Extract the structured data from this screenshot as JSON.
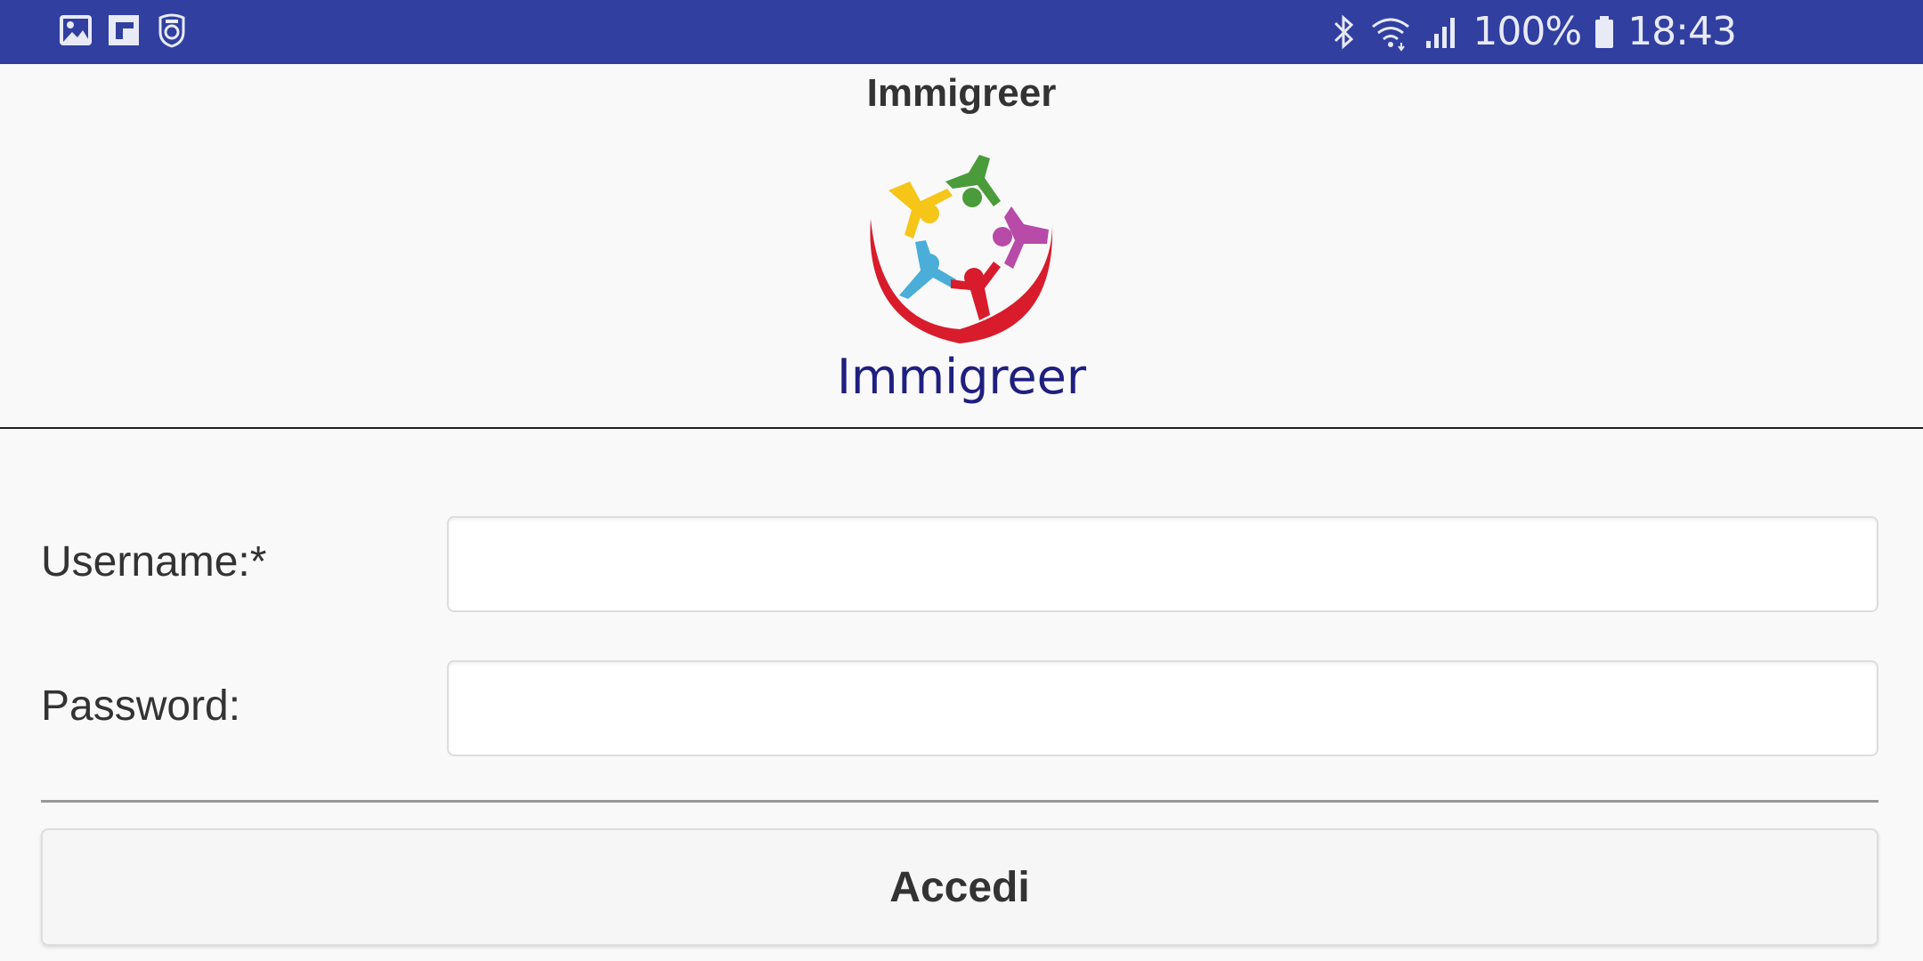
{
  "status_bar": {
    "left_icons": [
      "gallery-icon",
      "flipboard-icon",
      "soccer-app-icon"
    ],
    "right_icons": [
      "bluetooth-icon",
      "wifi-icon",
      "signal-icon",
      "battery-icon"
    ],
    "battery_level": "100%",
    "time": "18:43",
    "background_color": "#303fa0"
  },
  "header": {
    "title": "Immigreer"
  },
  "logo": {
    "text": "Immigreer",
    "colors": [
      "#f5c518",
      "#4a9b3a",
      "#b84aa8",
      "#4aaed8",
      "#d81c2c"
    ]
  },
  "form": {
    "username_label": "Username:*",
    "username_value": "",
    "password_label": "Password:",
    "password_value": "",
    "submit_label": "Accedi"
  }
}
